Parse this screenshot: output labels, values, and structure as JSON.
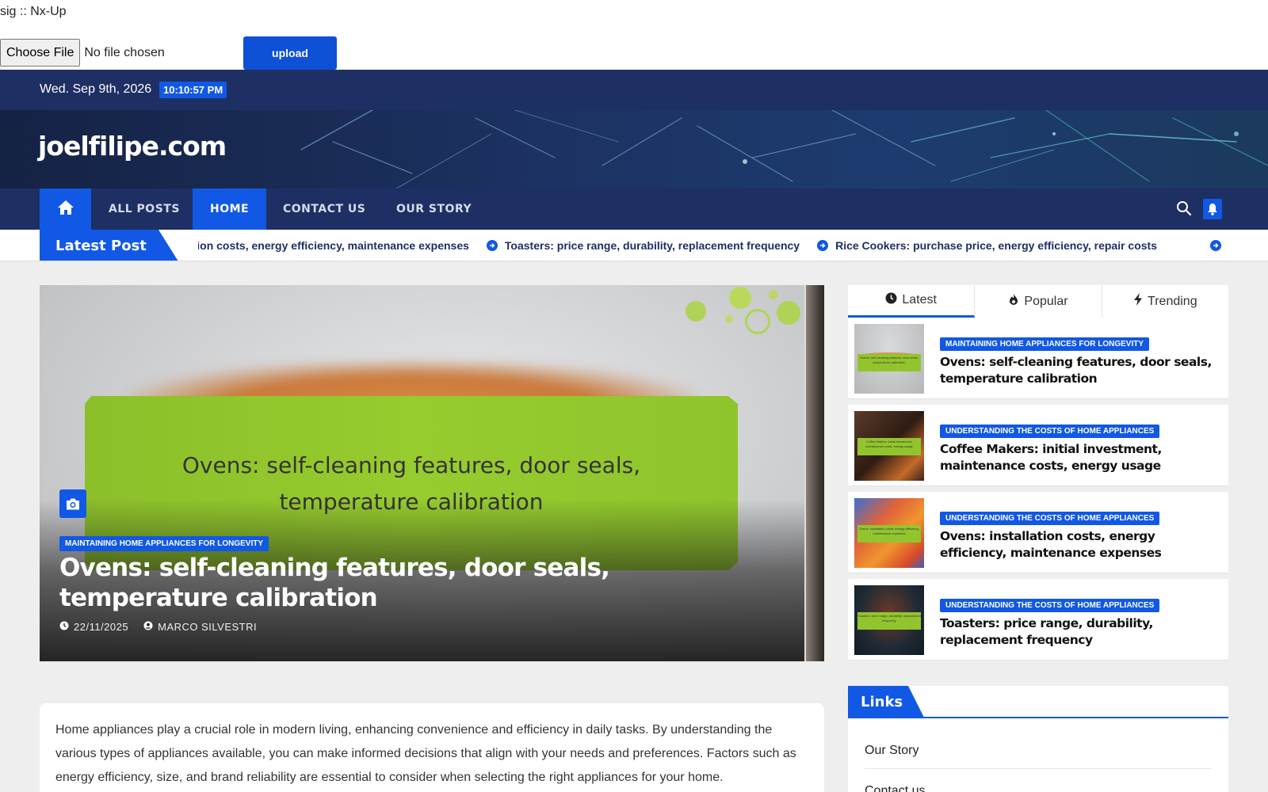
{
  "upload": {
    "sig_text": "sig :: Nx-Up",
    "choose_label": "Choose File",
    "no_file_text": "No file chosen",
    "upload_label": "upload"
  },
  "topbar": {
    "date": "Wed. Sep 9th, 2026",
    "time": "10:10:57 PM"
  },
  "site": {
    "title": "joelfilipe.com"
  },
  "nav": {
    "home_icon": "home-icon",
    "items": [
      {
        "label": "ALL POSTS"
      },
      {
        "label": "HOME"
      },
      {
        "label": "CONTACT US"
      },
      {
        "label": "OUR STORY"
      }
    ],
    "active": "HOME",
    "search_icon": "search-icon",
    "bell_icon": "bell-icon"
  },
  "ticker": {
    "label": "Latest Post",
    "items": [
      "Ovens: installation costs, energy efficiency, maintenance expenses",
      "Toasters: price range, durability, replacement frequency",
      "Rice Cookers: purchase price, energy efficiency, repair costs"
    ]
  },
  "hero": {
    "image_text_line1": "Ovens: self-cleaning features, door seals,",
    "image_text_line2": "temperature calibration",
    "category": "MAINTAINING HOME APPLIANCES FOR LONGEVITY",
    "title": "Ovens: self-cleaning features, door seals, temperature calibration",
    "date": "22/11/2025",
    "author": "MARCO SILVESTRI"
  },
  "tabs": [
    {
      "label": "Latest",
      "icon": "clock-icon"
    },
    {
      "label": "Popular",
      "icon": "fire-icon"
    },
    {
      "label": "Trending",
      "icon": "bolt-icon"
    }
  ],
  "sidebar_posts": [
    {
      "category": "MAINTAINING HOME APPLIANCES FOR LONGEVITY",
      "title": "Ovens: self-cleaning features, door seals, temperature calibration",
      "thumb_text": "Ovens: self-cleaning features, door seals, temperature calibration"
    },
    {
      "category": "UNDERSTANDING THE COSTS OF HOME APPLIANCES",
      "title": "Coffee Makers: initial investment, maintenance costs, energy usage",
      "thumb_text": "Coffee Makers: initial investment, maintenance costs, energy usage"
    },
    {
      "category": "UNDERSTANDING THE COSTS OF HOME APPLIANCES",
      "title": "Ovens: installation costs, energy efficiency, maintenance expenses",
      "thumb_text": "Ovens: installation costs, energy efficiency, maintenance expenses"
    },
    {
      "category": "UNDERSTANDING THE COSTS OF HOME APPLIANCES",
      "title": "Toasters: price range, durability, replacement frequency",
      "thumb_text": "Toasters: price range, durability, replacement frequency"
    }
  ],
  "links": {
    "label": "Links",
    "items": [
      "Our Story",
      "Contact us"
    ]
  },
  "article": {
    "text": "Home appliances play a crucial role in modern living, enhancing convenience and efficiency in daily tasks. By understanding the various types of appliances available, you can make informed decisions that align with your needs and preferences. Factors such as energy efficiency, size, and brand reliability are essential to consider when selecting the right appliances for your home."
  },
  "colors": {
    "accent": "#1158e5",
    "navy": "#1e2f64",
    "page_bg": "#eeeeee"
  }
}
